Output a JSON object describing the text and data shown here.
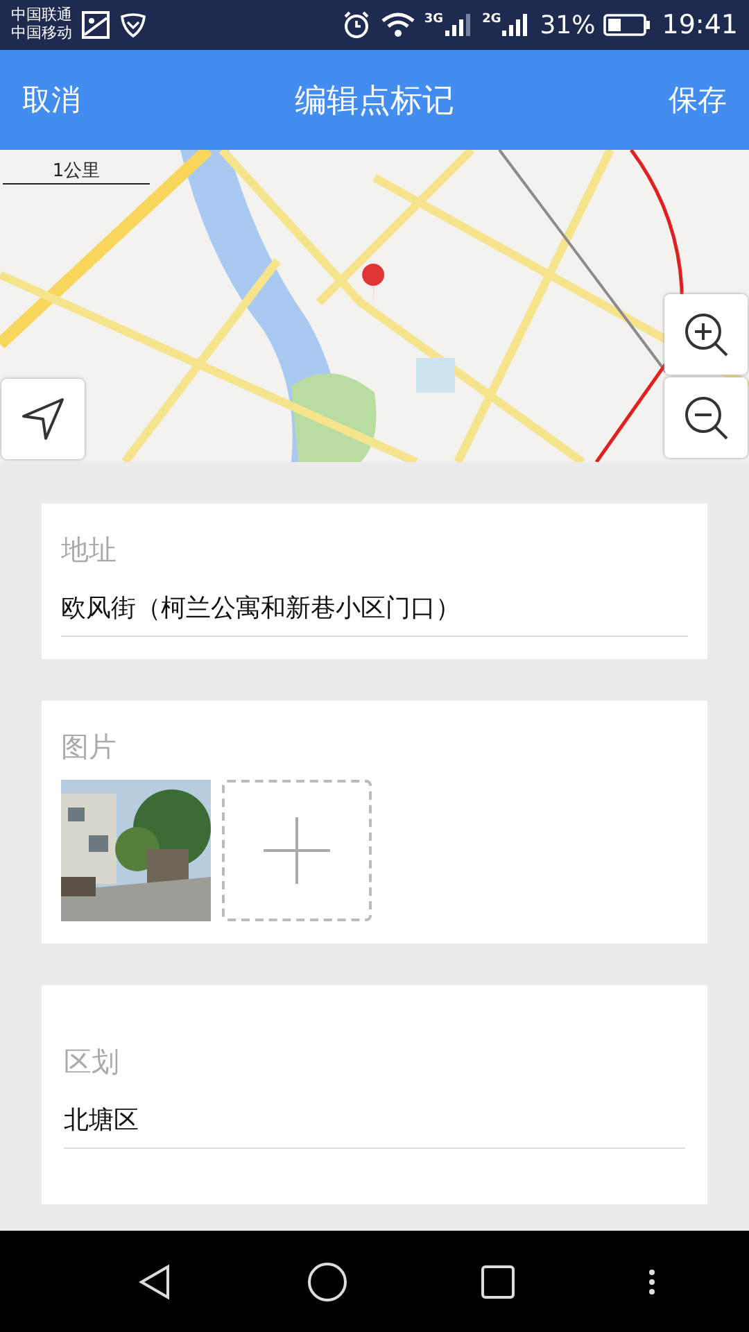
{
  "status_bar": {
    "carriers": [
      "中国联通",
      "中国移动"
    ],
    "networks": [
      "3G",
      "2G"
    ],
    "battery_text": "31%",
    "time": "19:41"
  },
  "header": {
    "cancel": "取消",
    "title": "编辑点标记",
    "save": "保存"
  },
  "map": {
    "kind": "picture",
    "scale": "1公里"
  },
  "fields": [
    {
      "kind": "text",
      "label": "地址",
      "value": "欧风街（柯兰公寓和新巷小区门口）"
    },
    {
      "kind": "images",
      "label": "图片"
    },
    {
      "kind": "text",
      "label": "区划",
      "value": "北塘区"
    }
  ]
}
